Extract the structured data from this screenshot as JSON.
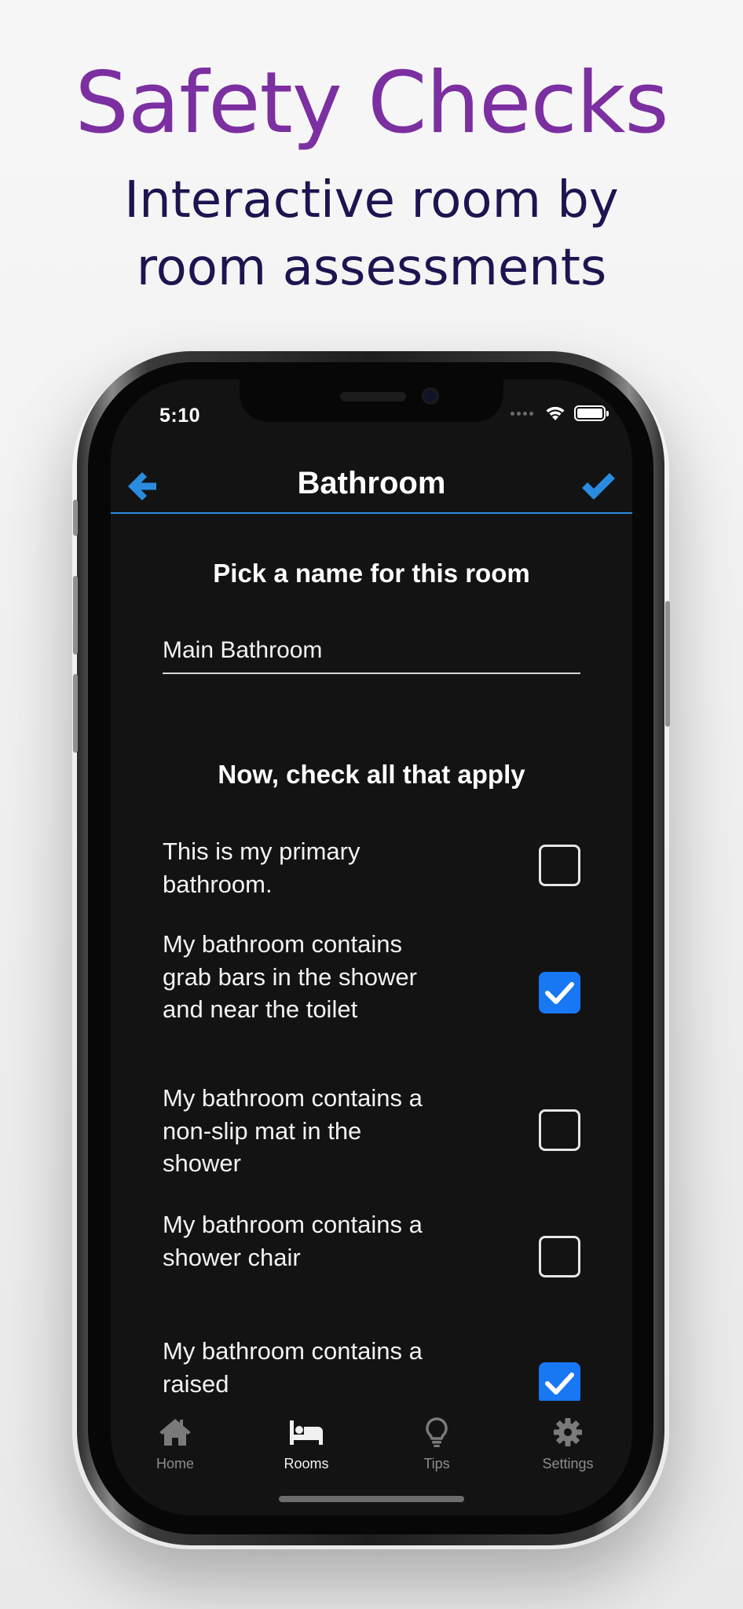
{
  "promo": {
    "headline": "Safety Checks",
    "subline_1": "Interactive room by",
    "subline_2": "room assessments"
  },
  "status_bar": {
    "time": "5:10"
  },
  "nav": {
    "title": "Bathroom",
    "back_icon": "arrow-left-icon",
    "done_icon": "checkmark-icon",
    "accent_color": "#2a8ce0"
  },
  "name_section": {
    "title": "Pick a name for this room",
    "value": "Main Bathroom"
  },
  "checklist": {
    "title": "Now, check all that apply",
    "items": [
      {
        "label": "This is my primary bathroom.",
        "checked": false
      },
      {
        "label": "My bathroom contains grab bars in the shower and near the toilet",
        "checked": true
      },
      {
        "label": "My bathroom contains a non-slip mat in the shower",
        "checked": false
      },
      {
        "label": "My bathroom contains a shower chair",
        "checked": false
      },
      {
        "label": "My bathroom contains a raised",
        "checked": true
      }
    ],
    "checked_color": "#1877f2"
  },
  "tabbar": {
    "tabs": [
      {
        "label": "Home",
        "icon": "home-icon",
        "active": false
      },
      {
        "label": "Rooms",
        "icon": "bed-icon",
        "active": true
      },
      {
        "label": "Tips",
        "icon": "lightbulb-icon",
        "active": false
      },
      {
        "label": "Settings",
        "icon": "gear-icon",
        "active": false
      }
    ]
  }
}
